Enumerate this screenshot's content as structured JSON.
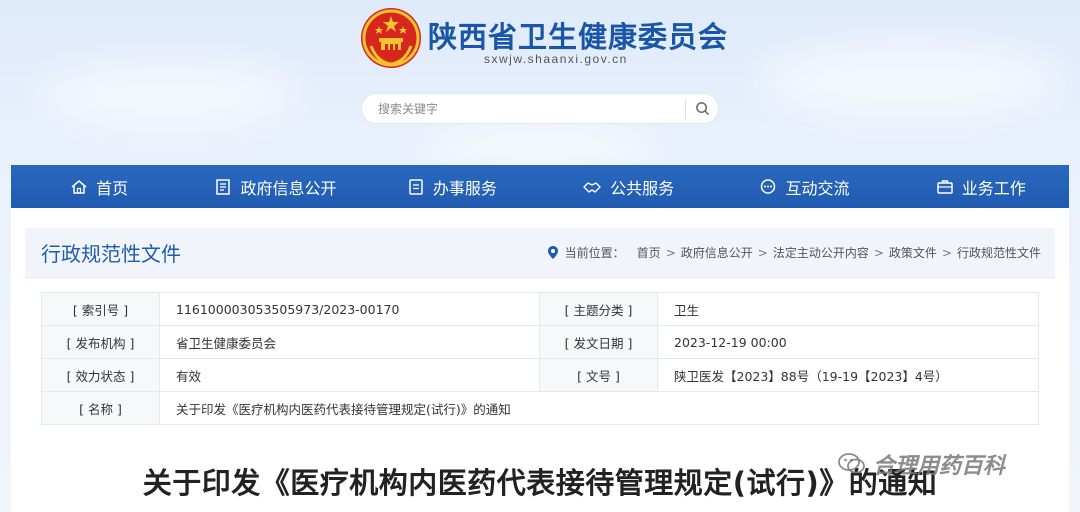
{
  "site": {
    "title": "陕西省卫生健康委员会",
    "domain": "sxwjw.shaanxi.gov.cn"
  },
  "search": {
    "placeholder": "搜索关键字",
    "icon": "search-icon"
  },
  "nav": {
    "items": [
      {
        "label": "首页",
        "icon": "home-icon"
      },
      {
        "label": "政府信息公开",
        "icon": "document-list-icon"
      },
      {
        "label": "办事服务",
        "icon": "file-icon"
      },
      {
        "label": "公共服务",
        "icon": "handshake-icon"
      },
      {
        "label": "互动交流",
        "icon": "chat-icon"
      },
      {
        "label": "业务工作",
        "icon": "briefcase-icon"
      }
    ]
  },
  "section": {
    "title": "行政规范性文件"
  },
  "breadcrumb": {
    "label": "当前位置：",
    "items": [
      "首页",
      "政府信息公开",
      "法定主动公开内容",
      "政策文件",
      "行政规范性文件"
    ],
    "separator": ">"
  },
  "info": {
    "index_label": "[ 索引号 ]",
    "index_value": "116100003053505973/2023-00170",
    "topic_label": "[ 主题分类 ]",
    "topic_value": "卫生",
    "org_label": "[ 发布机构 ]",
    "org_value": "省卫生健康委员会",
    "date_label": "[ 发文日期 ]",
    "date_value": "2023-12-19 00:00",
    "status_label": "[ 效力状态 ]",
    "status_value": "有效",
    "docno_label": "[ 文号 ]",
    "docno_value": "陕卫医发【2023】88号（19-19【2023】4号）",
    "name_label": "[ 名称 ]",
    "name_value": "关于印发《医疗机构内医药代表接待管理规定(试行)》的通知"
  },
  "document": {
    "title": "关于印发《医疗机构内医药代表接待管理规定(试行)》的通知"
  },
  "watermark": {
    "text": "合理用药百科"
  },
  "colors": {
    "nav_blue": "#1f5bb0",
    "title_blue": "#1a56a8",
    "status_green": "#2e8b2e"
  }
}
